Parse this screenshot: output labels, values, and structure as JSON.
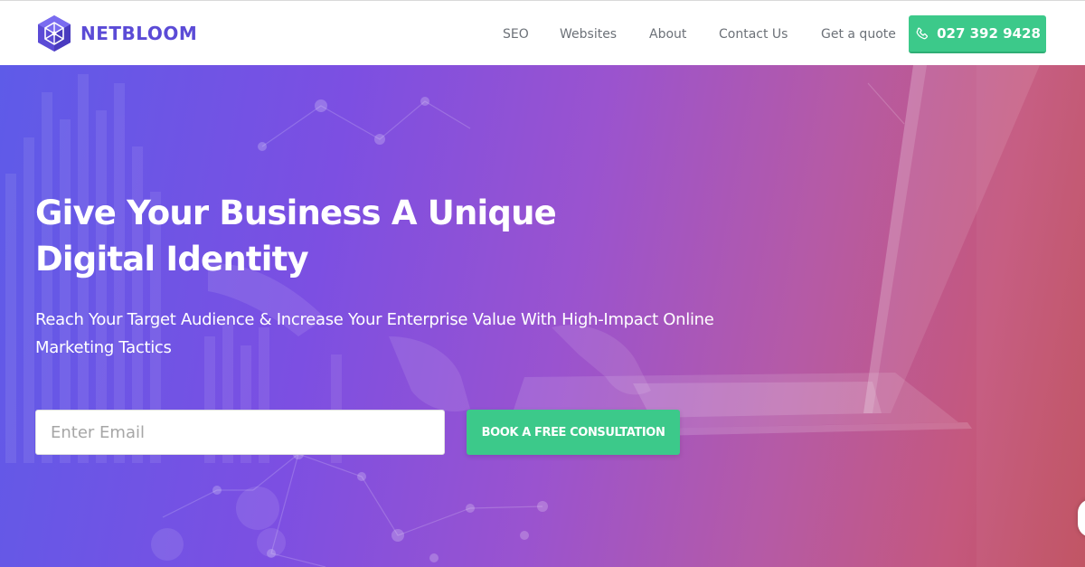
{
  "brand": {
    "name": "NETBLOOM",
    "icon": "cube-logo-icon",
    "color": "#5b4bd6"
  },
  "nav": {
    "items": [
      {
        "label": "SEO"
      },
      {
        "label": "Websites"
      },
      {
        "label": "About"
      },
      {
        "label": "Contact Us"
      },
      {
        "label": "Get a quote"
      }
    ],
    "phone": {
      "label": "027 392 9428",
      "icon": "phone-icon",
      "color": "#3cc98a"
    }
  },
  "hero": {
    "title_line1": "Give Your Business A Unique",
    "title_line2": "Digital Identity",
    "subtitle": "Reach Your Target Audience & Increase Your Enterprise Value With High-Impact Online Marketing Tactics",
    "email_placeholder": "Enter Email",
    "email_value": "",
    "cta_label": "BOOK A FREE CONSULTATION",
    "cta_color": "#3cc98a",
    "gradient_colors": [
      "#5e5be8",
      "#7c4fe2",
      "#9a53cf",
      "#b55aa6",
      "#c4587e",
      "#bf4f5e"
    ]
  }
}
